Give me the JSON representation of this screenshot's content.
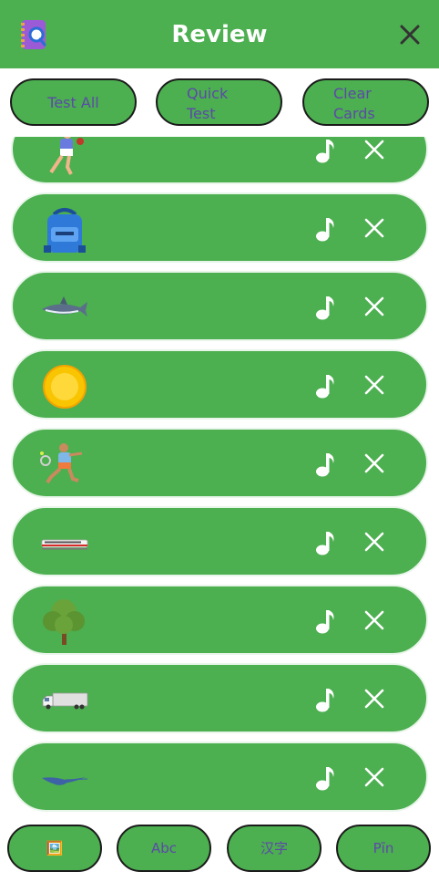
{
  "header": {
    "title": "Review",
    "icon": "notebook-search-icon",
    "close_icon": "close-icon"
  },
  "top_buttons": {
    "test_all": "Test All",
    "quick_test": "Quick Test",
    "clear_cards": "Clear Cards"
  },
  "cards": [
    {
      "image": "baseball-player-icon",
      "sound_icon": "music-note-icon",
      "remove_icon": "close-icon"
    },
    {
      "image": "backpack-icon",
      "sound_icon": "music-note-icon",
      "remove_icon": "close-icon"
    },
    {
      "image": "shark-icon",
      "sound_icon": "music-note-icon",
      "remove_icon": "close-icon"
    },
    {
      "image": "sun-icon",
      "sound_icon": "music-note-icon",
      "remove_icon": "close-icon"
    },
    {
      "image": "tennis-player-icon",
      "sound_icon": "music-note-icon",
      "remove_icon": "close-icon"
    },
    {
      "image": "train-icon",
      "sound_icon": "music-note-icon",
      "remove_icon": "close-icon"
    },
    {
      "image": "tree-icon",
      "sound_icon": "music-note-icon",
      "remove_icon": "close-icon"
    },
    {
      "image": "truck-icon",
      "sound_icon": "music-note-icon",
      "remove_icon": "close-icon"
    },
    {
      "image": "stingray-icon",
      "sound_icon": "music-note-icon",
      "remove_icon": "close-icon"
    }
  ],
  "bottom_buttons": {
    "picture": "🖼️",
    "latin": "Abc",
    "hanzi": "汉字",
    "pinyin": "Pīn"
  },
  "colors": {
    "primary": "#4caf50",
    "button_text": "#5c4aa8",
    "border": "#1b1b1b"
  }
}
